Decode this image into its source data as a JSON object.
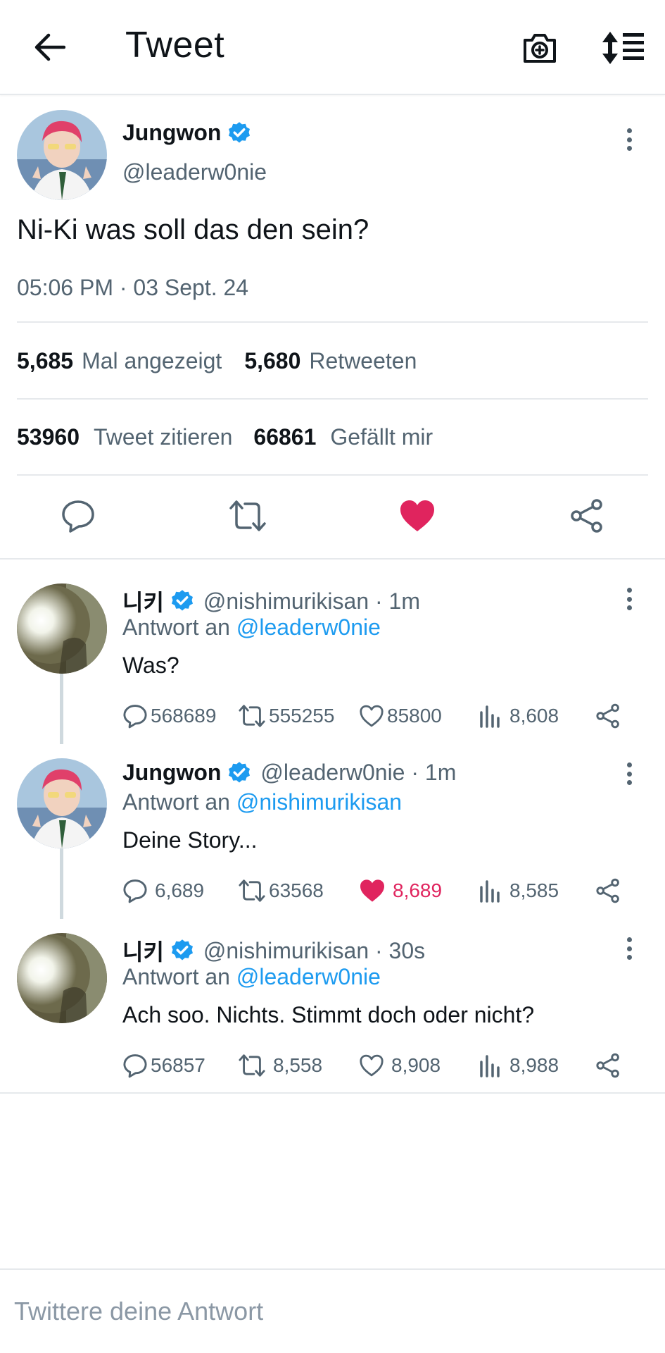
{
  "header": {
    "title": "Tweet",
    "back_icon": "arrow-left-icon",
    "camera_icon": "camera-plus-icon",
    "sort_icon": "sort-list-icon"
  },
  "main_tweet": {
    "author_name": "Jungwon",
    "author_handle": "@leaderw0nie",
    "text": "Ni-Ki was soll das den sein?",
    "timestamp": "05:06 PM · 03 Sept. 24",
    "views_count": "5,685",
    "views_label": "Mal angezeigt",
    "retweets_count": "5,680",
    "retweets_label": "Retweeten",
    "quotes_count": "53960",
    "quotes_label": "Tweet zitieren",
    "likes_count": "66861",
    "likes_label": "Gefällt mir",
    "liked": true
  },
  "replies": [
    {
      "author_name": "니키",
      "author_handle": "@nishimurikisan · 1m",
      "reply_prefix": "Antwort an",
      "reply_to": "@leaderw0nie",
      "text": "Was?",
      "comments": "568689",
      "retweets": "555255",
      "likes": "85800",
      "views": "8,608",
      "liked": false
    },
    {
      "author_name": "Jungwon",
      "author_handle": "@leaderw0nie · 1m",
      "reply_prefix": "Antwort an",
      "reply_to": "@nishimurikisan",
      "text": "Deine Story...",
      "comments": "6,689",
      "retweets": "63568",
      "likes": "8,689",
      "views": "8,585",
      "liked": true
    },
    {
      "author_name": "니키",
      "author_handle": "@nishimurikisan · 30s",
      "reply_prefix": "Antwort an",
      "reply_to": "@leaderw0nie",
      "text": "Ach soo. Nichts. Stimmt doch oder nicht?",
      "comments": "56857",
      "retweets": "8,558",
      "likes": "8,908",
      "views": "8,988",
      "liked": false
    }
  ],
  "compose": {
    "placeholder": "Twittere deine Antwort"
  },
  "colors": {
    "accent_blue": "#1d9bf0",
    "like_red": "#e0245e",
    "secondary_text": "#536471",
    "divider": "#e6e9ec"
  }
}
